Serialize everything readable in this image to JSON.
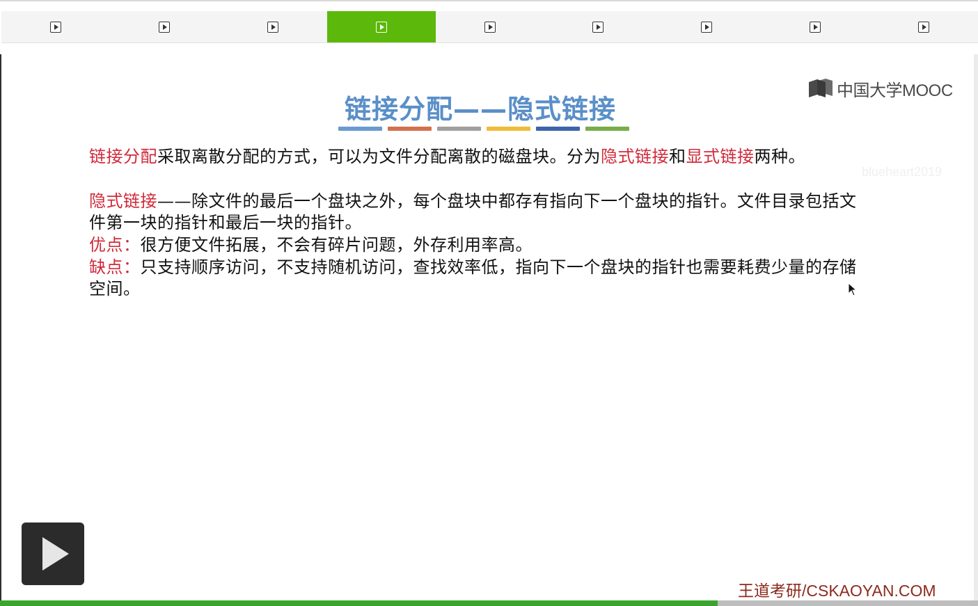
{
  "tabs": {
    "count": 9,
    "active_index": 3,
    "icon": "play-square-icon"
  },
  "slide": {
    "logo_text": "中国大学MOOC",
    "watermark": "blueheart2019",
    "title": "链接分配——隐式链接",
    "title_bar_colors": [
      "#6a9ad0",
      "#d2714e",
      "#a0a0a0",
      "#efbb3b",
      "#3c64a8",
      "#79ac4a"
    ],
    "p1": {
      "a": "链接分配",
      "b": "采取离散分配的方式，可以为文件分配离散的磁盘块。分为",
      "c": "隐式链接",
      "d": "和",
      "e": "显式链接",
      "f": "两种。"
    },
    "p2": {
      "a": "隐式链接",
      "b": "——除文件的最后一个盘块之外，每个盘块中都存有指向下一个盘块的指针。文件目录包括文件第一块的指针和最后一块的指针。"
    },
    "p3": {
      "a": "优点：",
      "b": "很方便文件拓展，不会有碎片问题，外存利用率高。"
    },
    "p4": {
      "a": "缺点：",
      "b": "只支持顺序访问，不支持随机访问，查找效率低，指向下一个盘块的指针也需要耗费少量的存储空间。"
    },
    "footer_brand": "王道考研/CSKAOYAN.COM"
  },
  "player": {
    "play_icon": "play-icon",
    "progress_percent": 73.4,
    "accent": "#3aa52d"
  }
}
